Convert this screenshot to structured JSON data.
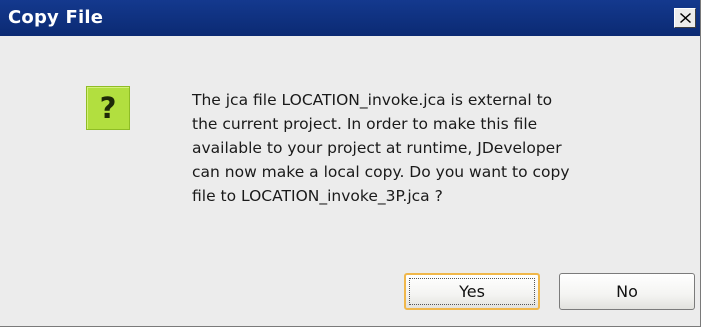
{
  "dialog": {
    "title": "Copy File",
    "icon": "question-mark-icon",
    "icon_glyph": "?",
    "icon_color": "#b2df3f",
    "title_bar_color": "#0b2a73",
    "message_lines": [
      "The jca file LOCATION_invoke.jca is external to",
      "the current project. In order to make this file",
      "available to your project at runtime, JDeveloper",
      "can now make a local copy. Do you want to copy",
      "file to LOCATION_invoke_3P.jca ?"
    ],
    "buttons": {
      "yes_label": "Yes",
      "no_label": "No"
    },
    "default_button": "Yes"
  }
}
